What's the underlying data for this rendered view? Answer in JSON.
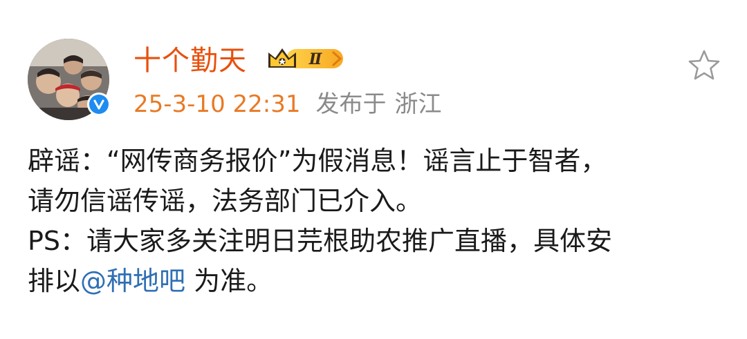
{
  "post": {
    "username": "十个勤天",
    "vip_level": "Ⅱ",
    "timestamp": "25-3-10 22:31",
    "location_prefix": "发布于",
    "location": "浙江",
    "content": {
      "line1": "辟谣：“网传商务报价”为假消息！谣言止于智者，",
      "line2": "请勿信谣传谣，法务部门已介入。",
      "line3": "PS：请大家多关注明日芫根助农推广直播，具体安",
      "line4_before": "排以",
      "mention": "@种地吧",
      "line4_after": " 为准。"
    }
  },
  "icons": {
    "avatar": "avatar-image",
    "verified": "verified-icon",
    "vip": "crown-vip-icon",
    "favorite": "star-outline-icon"
  },
  "colors": {
    "username": "#e8500c",
    "timestamp": "#e87a25",
    "location": "#8a8a8a",
    "mention": "#2f6fb4",
    "verified": "#1e8cf0"
  }
}
